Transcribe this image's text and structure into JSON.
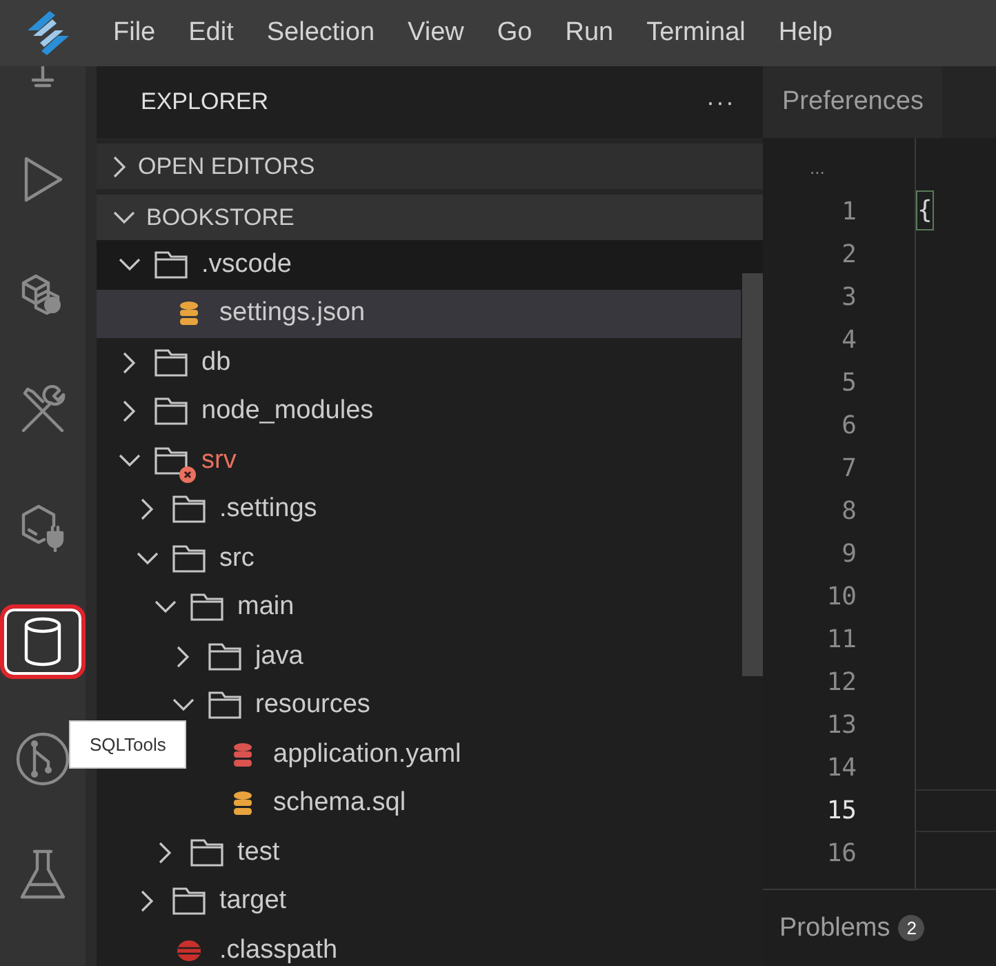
{
  "menu": [
    "File",
    "Edit",
    "Selection",
    "View",
    "Go",
    "Run",
    "Terminal",
    "Help"
  ],
  "activity": [
    {
      "kind": "debug-cut",
      "selected": false
    },
    {
      "kind": "run",
      "selected": false
    },
    {
      "kind": "cubes",
      "selected": false
    },
    {
      "kind": "tools",
      "selected": false
    },
    {
      "kind": "plug",
      "selected": false
    },
    {
      "kind": "database",
      "selected": true
    },
    {
      "kind": "branch",
      "selected": false
    },
    {
      "kind": "flask",
      "selected": false
    }
  ],
  "tooltip": "SQLTools",
  "sidebar": {
    "title": "EXPLORER",
    "more": "···",
    "sections": [
      {
        "label": "OPEN EDITORS",
        "expanded": false
      },
      {
        "label": "BOOKSTORE",
        "expanded": true
      }
    ],
    "tree": [
      {
        "name": ".vscode",
        "kind": "folder",
        "expanded": true,
        "children": [
          {
            "name": "settings.json",
            "kind": "db-file",
            "color": "#e8a33d",
            "selected": true
          }
        ]
      },
      {
        "name": "db",
        "kind": "folder",
        "expanded": false
      },
      {
        "name": "node_modules",
        "kind": "folder",
        "expanded": false
      },
      {
        "name": "srv",
        "kind": "folder",
        "expanded": true,
        "error": true,
        "children": [
          {
            "name": ".settings",
            "kind": "folder",
            "expanded": false
          },
          {
            "name": "src",
            "kind": "folder",
            "expanded": true,
            "children": [
              {
                "name": "main",
                "kind": "folder",
                "expanded": true,
                "children": [
                  {
                    "name": "java",
                    "kind": "folder",
                    "expanded": false
                  },
                  {
                    "name": "resources",
                    "kind": "folder",
                    "expanded": true,
                    "children": [
                      {
                        "name": "application.yaml",
                        "kind": "db-file",
                        "color": "#d9534f",
                        "selected": false
                      },
                      {
                        "name": "schema.sql",
                        "kind": "db-file",
                        "color": "#e8a33d",
                        "selected": false
                      }
                    ]
                  }
                ]
              },
              {
                "name": "test",
                "kind": "folder",
                "expanded": false
              }
            ]
          },
          {
            "name": "target",
            "kind": "folder",
            "expanded": false
          },
          {
            "name": ".classpath",
            "kind": "ball-file",
            "color": "#c9302c",
            "selected": false
          }
        ]
      }
    ]
  },
  "editor": {
    "tab": "Preferences",
    "fold": "...",
    "lines": [
      {
        "number": "1",
        "current": false
      },
      {
        "number": "2",
        "current": false
      },
      {
        "number": "3",
        "current": false
      },
      {
        "number": "4",
        "current": false
      },
      {
        "number": "5",
        "current": false
      },
      {
        "number": "6",
        "current": false
      },
      {
        "number": "7",
        "current": false
      },
      {
        "number": "8",
        "current": false
      },
      {
        "number": "9",
        "current": false
      },
      {
        "number": "10",
        "current": false
      },
      {
        "number": "11",
        "current": false
      },
      {
        "number": "12",
        "current": false
      },
      {
        "number": "13",
        "current": false
      },
      {
        "number": "14",
        "current": false
      },
      {
        "number": "15",
        "current": true
      },
      {
        "number": "16",
        "current": false
      }
    ],
    "first_line_text": "{"
  },
  "panel": {
    "tab": "Problems",
    "badge": "2"
  }
}
